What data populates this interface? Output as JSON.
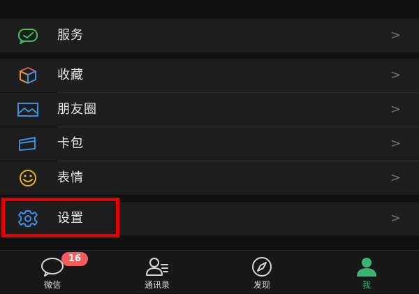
{
  "menu": {
    "service": {
      "label": "服务",
      "icon": "service-icon"
    },
    "favorites": {
      "label": "收藏",
      "icon": "cube-icon"
    },
    "moments": {
      "label": "朋友圈",
      "icon": "photo-icon"
    },
    "cards": {
      "label": "卡包",
      "icon": "card-icon"
    },
    "stickers": {
      "label": "表情",
      "icon": "smiley-icon"
    },
    "settings": {
      "label": "设置",
      "icon": "gear-icon"
    },
    "chevron": ">"
  },
  "tabbar": {
    "chats": {
      "label": "微信",
      "badge": "16",
      "icon": "chat-bubble-icon"
    },
    "contacts": {
      "label": "通讯录",
      "icon": "contacts-icon"
    },
    "discover": {
      "label": "发现",
      "icon": "compass-icon"
    },
    "me": {
      "label": "我",
      "icon": "person-icon"
    }
  },
  "colors": {
    "accent_green": "#3cb371",
    "badge_red": "#f25c5c",
    "highlight_red": "#e50000",
    "background": "#111111",
    "row_background": "#1e1e1e"
  }
}
